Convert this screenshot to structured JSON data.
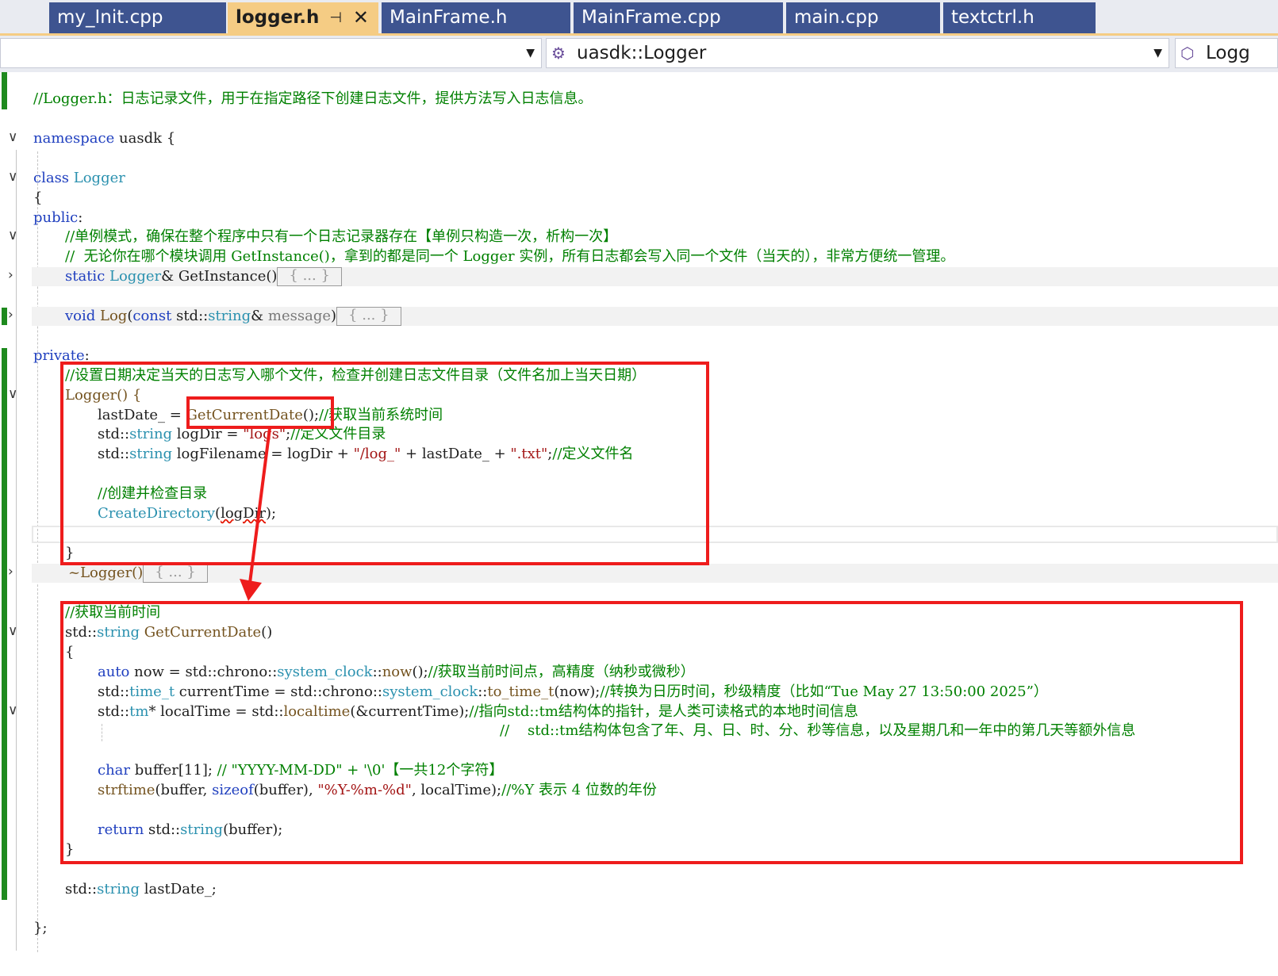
{
  "tabs": [
    {
      "label": "my_Init.cpp"
    },
    {
      "label": "logger.h",
      "active": true,
      "pin": "⊣",
      "close": "✕"
    },
    {
      "label": "MainFrame.h"
    },
    {
      "label": "MainFrame.cpp"
    },
    {
      "label": "main.cpp"
    },
    {
      "label": "textctrl.h"
    }
  ],
  "navbar": {
    "scope_value": "",
    "member_value": "uasdk::Logger",
    "member_icon": "class-icon",
    "third_value": "Logg",
    "third_icon": "locked-class-icon"
  },
  "code": {
    "l1_comment": "//Logger.h：日志记录文件，用于在指定路径下创建日志文件，提供方法写入日志信息。",
    "l2_kw": "namespace",
    "l2_rest": " uasdk {",
    "l3_kw": "class",
    "l3_type": " Logger",
    "l4": "{",
    "l5_kw": "public",
    "l5_rest": ":",
    "l6_comment": "//单例模式，确保在整个程序中只有一个日志记录器存在【单例只构造一次，析构一次】",
    "l7_comment": "//  无论你在哪个模块调用 GetInstance()，拿到的都是同一个 Logger 实例，所有日志都会写入同一个文件（当天的），非常方便统一管理。",
    "l8_kw": "static",
    "l8_type": " Logger",
    "l8_rest": "& GetInstance()",
    "collapsed": "{ ... }",
    "l9_kw": "void",
    "l9_fn": " Log",
    "l9_p1": "(",
    "l9_kw2": "const",
    "l9_p2": " std::",
    "l9_type": "string",
    "l9_p3": "& ",
    "l9_param": "message",
    "l9_p4": ")",
    "l10_kw": "private",
    "l10_rest": ":",
    "l11_comment": "//设置日期决定当天的日志写入哪个文件，检查并创建日志文件目录（文件名加上当天日期）",
    "l12": "Logger() {",
    "l13_a": "lastDate_ = ",
    "l13_fn": "GetCurrentDate",
    "l13_b": "();",
    "l13_comment": "//获取当前系统时间",
    "l14_a": "std::",
    "l14_type": "string",
    "l14_b": " logDir = ",
    "l14_str": "\"logs\"",
    "l14_c": ";",
    "l14_comment": "//定义文件目录",
    "l15_a": "std::",
    "l15_type": "string",
    "l15_b": " logFilename = logDir + ",
    "l15_str1": "\"/log_\"",
    "l15_c": " + lastDate_ + ",
    "l15_str2": "\".txt\"",
    "l15_d": ";",
    "l15_comment": "//定义文件名",
    "l16_comment": "//创建并检查目录",
    "l17_fn": "CreateDirectory",
    "l17_a": "(",
    "l17_arg": "logDir",
    "l17_b": ");",
    "l18": "}",
    "l19": "~Logger()",
    "l20_comment": "//获取当前时间",
    "l21_a": "std::",
    "l21_type": "string",
    "l21_fn": " GetCurrentDate",
    "l21_b": "()",
    "l22": "{",
    "l23_kw": "auto",
    "l23_a": " now = std::chrono::",
    "l23_type": "system_clock",
    "l23_b": "::",
    "l23_fn": "now",
    "l23_c": "();",
    "l23_comment": "//获取当前时间点，高精度（纳秒或微秒）",
    "l24_a": "std::",
    "l24_type": "time_t",
    "l24_b": " currentTime = std::chrono::",
    "l24_type2": "system_clock",
    "l24_c": "::",
    "l24_fn": "to_time_t",
    "l24_d": "(now);",
    "l24_comment": "//转换为日历时间，秒级精度（比如“Tue May 27 13:50:00 2025”）",
    "l25_a": "std::",
    "l25_type": "tm",
    "l25_b": "* localTime = std::",
    "l25_fn": "localtime",
    "l25_c": "(&currentTime);",
    "l25_comment": "//指向std::tm结构体的指针，是人类可读格式的本地时间信息",
    "l26_comment": "//    std::tm结构体包含了年、月、日、时、分、秒等信息，以及星期几和一年中的第几天等额外信息",
    "l27_kw": "char",
    "l27_a": " buffer[11]; ",
    "l27_comment": "// \"YYYY-MM-DD\" + '\\0'【一共12个字符】",
    "l28_fn": "strftime",
    "l28_a": "(buffer, ",
    "l28_kw": "sizeof",
    "l28_b": "(buffer), ",
    "l28_str": "\"%Y-%m-%d\"",
    "l28_c": ", localTime);",
    "l28_comment": "//%Y 表示 4 位数的年份",
    "l29_kw": "return",
    "l29_a": " std::",
    "l29_type": "string",
    "l29_b": "(buffer);",
    "l30": "}",
    "l31_a": "std::",
    "l31_type": "string",
    "l31_b": " lastDate_;",
    "l32": "};"
  },
  "colors": {
    "tab_bg": "#3e5490",
    "tab_active_bg": "#f5cc84",
    "annotation_red": "#ee1c1c",
    "gutter_green": "#1e8a1e"
  }
}
